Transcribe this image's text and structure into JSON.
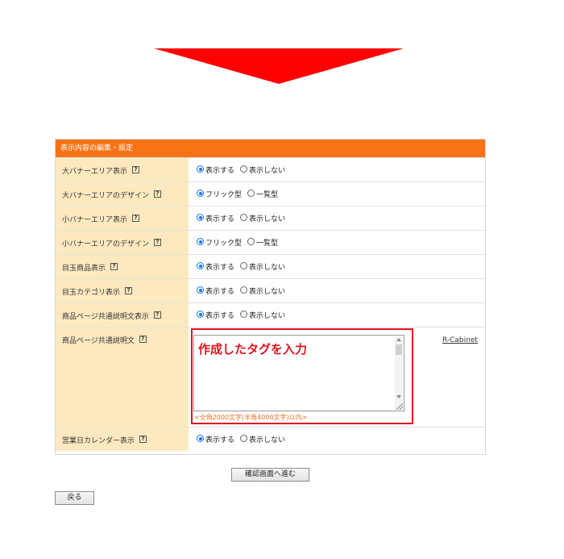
{
  "colors": {
    "arrow": "#ff0000",
    "header": "#f97316",
    "label_bg": "#fde9c0",
    "highlight": "#e0141e",
    "note": "#e8702b"
  },
  "panel": {
    "title": "表示内容の編集・設定"
  },
  "rows": [
    {
      "label": "大バナーエリア表示",
      "options": [
        "表示する",
        "表示しない"
      ],
      "selected": 0
    },
    {
      "label": "大バナーエリアのデザイン",
      "options": [
        "フリック型",
        "一覧型"
      ],
      "selected": 0
    },
    {
      "label": "小バナーエリア表示",
      "options": [
        "表示する",
        "表示しない"
      ],
      "selected": 0
    },
    {
      "label": "小バナーエリアのデザイン",
      "options": [
        "フリック型",
        "一覧型"
      ],
      "selected": 0
    },
    {
      "label": "目玉商品表示",
      "options": [
        "表示する",
        "表示しない"
      ],
      "selected": 0
    },
    {
      "label": "目玉カテゴリ表示",
      "options": [
        "表示する",
        "表示しない"
      ],
      "selected": 0
    },
    {
      "label": "商品ページ共通説明文表示",
      "options": [
        "表示する",
        "表示しない"
      ],
      "selected": 0
    }
  ],
  "description_row": {
    "label": "商品ページ共通説明文",
    "textarea_value": "作成したタグを入力",
    "char_limit": "<全角2000文字(半角4000文字)以内>",
    "link": "R-Cabinet"
  },
  "calendar_row": {
    "label": "営業日カレンダー表示",
    "options": [
      "表示する",
      "表示しない"
    ],
    "selected": 0
  },
  "buttons": {
    "confirm": "確認画面へ進む",
    "back": "戻る"
  }
}
